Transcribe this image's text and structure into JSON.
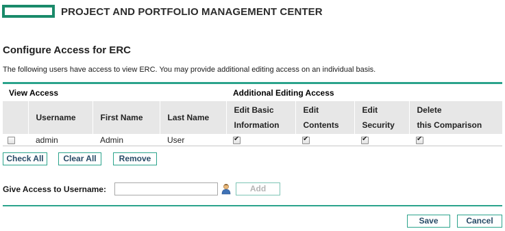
{
  "header": {
    "title": "PROJECT AND PORTFOLIO MANAGEMENT CENTER",
    "logo_icon": "hp-logo-bar"
  },
  "page": {
    "title": "Configure Access for ERC",
    "intro": "The following users have access to view ERC. You may provide additional editing access on an individual basis."
  },
  "sections": {
    "view_access": "View Access",
    "additional_editing": "Additional Editing Access"
  },
  "table": {
    "columns": {
      "username": "Username",
      "first_name": "First Name",
      "last_name": "Last Name",
      "edit_basic_1": "Edit Basic",
      "edit_basic_2": "Information",
      "edit_contents_1": "Edit",
      "edit_contents_2": "Contents",
      "edit_security_1": "Edit",
      "edit_security_2": "Security",
      "delete_1": "Delete",
      "delete_2": "this Comparison"
    },
    "rows": [
      {
        "selected": false,
        "username": "admin",
        "first_name": "Admin",
        "last_name": "User",
        "edit_basic": true,
        "edit_contents": true,
        "edit_security": true,
        "delete_comparison": true
      }
    ]
  },
  "actions": {
    "check_all": "Check All",
    "clear_all": "Clear All",
    "remove": "Remove"
  },
  "give_access": {
    "label": "Give Access to Username:",
    "value": "",
    "user_picker_icon": "user-picker-icon",
    "add_label": "Add"
  },
  "footer": {
    "save_label": "Save",
    "cancel_label": "Cancel"
  },
  "colors": {
    "accent": "#2aa38b",
    "button_text": "#274a66",
    "header_bg": "#e7e7e7"
  }
}
